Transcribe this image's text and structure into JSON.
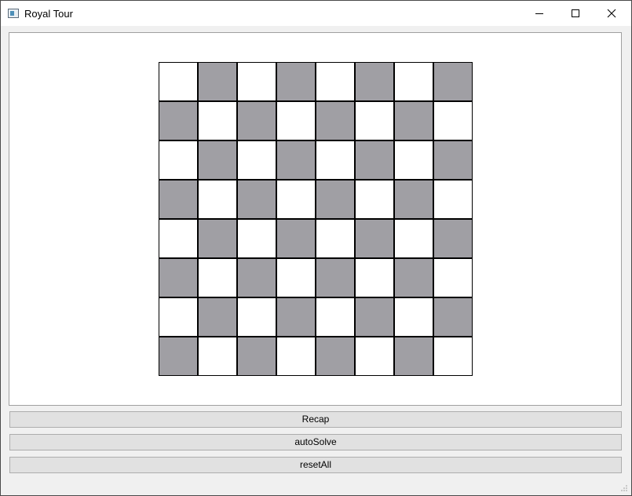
{
  "window": {
    "title": "Royal Tour",
    "icons": {
      "app": "app-window-icon",
      "minimize": "minimize-icon",
      "maximize": "maximize-icon",
      "close": "close-icon"
    }
  },
  "board": {
    "rows": 8,
    "cols": 8,
    "light_color": "#ffffff",
    "dark_color": "#a09fa4",
    "first_square": "light"
  },
  "buttons": {
    "recap": "Recap",
    "auto_solve": "autoSolve",
    "reset_all": "resetAll"
  }
}
